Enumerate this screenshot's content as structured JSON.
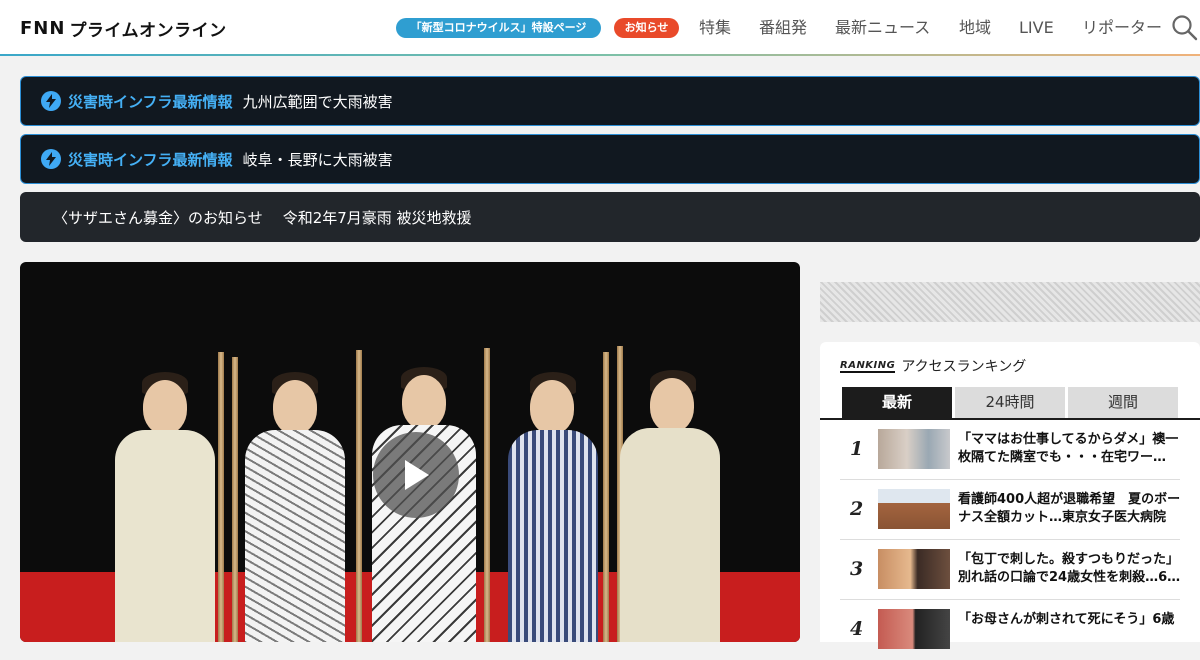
{
  "header": {
    "logo_prefix": "FNN",
    "logo_text": "プライムオンライン",
    "corona_pill": "「新型コロナウイルス」特設ページ",
    "notice_pill": "お知らせ",
    "nav": [
      "特集",
      "番組発",
      "最新ニュース",
      "地域",
      "LIVE",
      "リポーター"
    ]
  },
  "alerts": [
    {
      "tag": "災害時インフラ最新情報",
      "message": "九州広範囲で大雨被害"
    },
    {
      "tag": "災害時インフラ最新情報",
      "message": "岐阜・長野に大雨被害"
    }
  ],
  "banner": {
    "part1": "〈サザエさん募金〉のお知らせ",
    "part2": "令和2年7月豪雨 被災地救援"
  },
  "ranking": {
    "logo": "RANKING",
    "title": "アクセスランキング",
    "tabs": [
      "最新",
      "24時間",
      "週間"
    ],
    "items": [
      {
        "rank": "1",
        "text": "「ママはお仕事してるからダメ」襖一枚隔てた隣室でも・・・在宅ワー…"
      },
      {
        "rank": "2",
        "text": "看護師400人超が退職希望　夏のボーナス全額カット…東京女子医大病院"
      },
      {
        "rank": "3",
        "text": "「包丁で刺した。殺すつもりだった」別れ話の口論で24歳女性を刺殺…6…"
      },
      {
        "rank": "4",
        "text": "「お母さんが刺されて死にそう」6歳"
      }
    ]
  },
  "colors": {
    "accent_blue": "#3fa9f5",
    "notice_red": "#e94a2a",
    "corona_blue": "#2f9ed1"
  }
}
